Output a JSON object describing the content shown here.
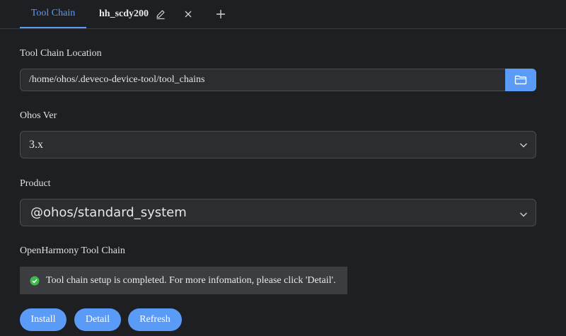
{
  "tabs": {
    "active_label": "Tool Chain",
    "second_label": "hh_scdy200"
  },
  "toolchain_location": {
    "label": "Tool Chain Location",
    "value": "/home/ohos/.deveco-device-tool/tool_chains"
  },
  "ohos_ver": {
    "label": "Ohos Ver",
    "value": "3.x"
  },
  "product": {
    "label": "Product",
    "value": "@ohos/standard_system"
  },
  "openharmony_toolchain": {
    "label": "OpenHarmony Tool Chain",
    "status_message": "Tool chain setup is completed. For more infomation, please click 'Detail'."
  },
  "buttons": {
    "install": "Install",
    "detail": "Detail",
    "refresh": "Refresh"
  },
  "colors": {
    "accent": "#5b9bf8",
    "success": "#3fb950",
    "background": "#1e1f22"
  },
  "icons": {
    "edit": "pencil-icon",
    "close": "close-icon",
    "add": "plus-icon",
    "folder": "folder-icon",
    "dropdown": "chevron-down-icon",
    "success": "check-circle-icon"
  }
}
